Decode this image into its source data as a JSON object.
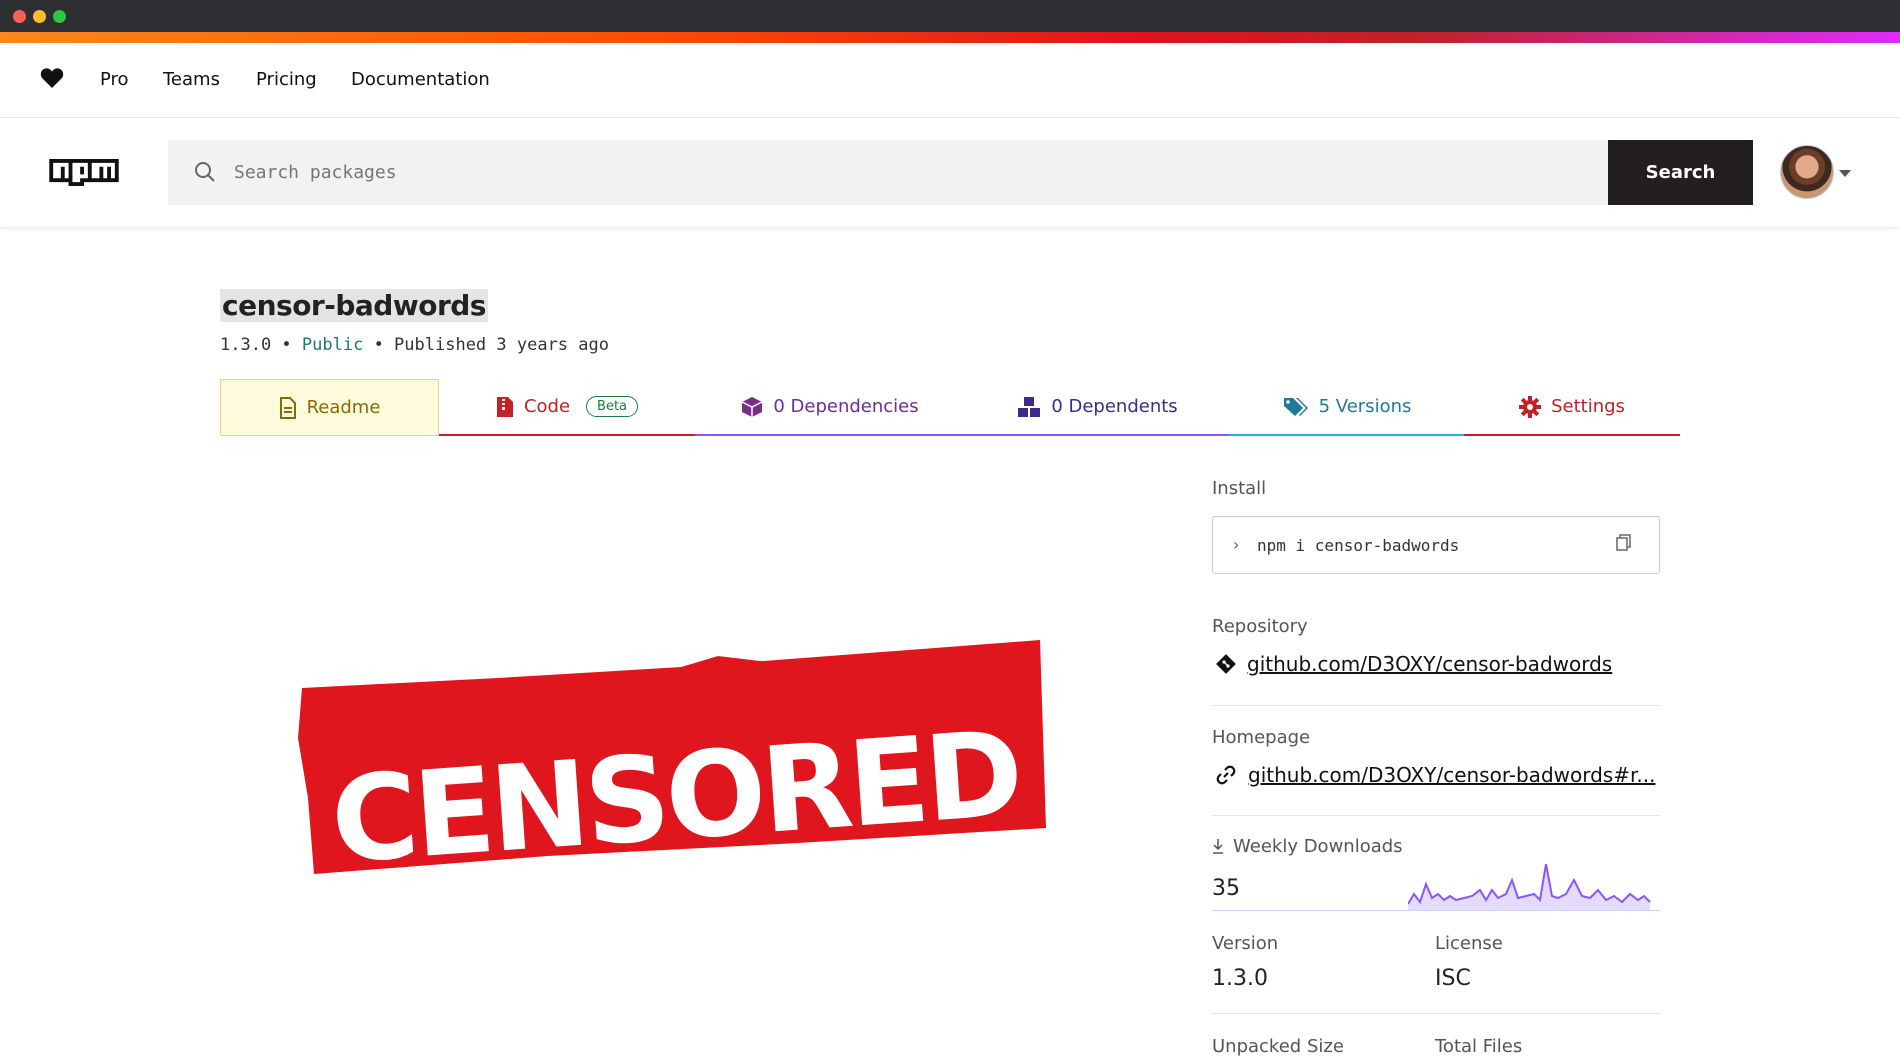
{
  "topnav": {
    "items": [
      "Pro",
      "Teams",
      "Pricing",
      "Documentation"
    ]
  },
  "header": {
    "search_placeholder": "Search packages",
    "search_button": "Search"
  },
  "package": {
    "name": "censor-badwords",
    "version": "1.3.0",
    "visibility": "Public",
    "published": "Published 3 years ago"
  },
  "tabs": {
    "readme": "Readme",
    "code": "Code",
    "code_badge": "Beta",
    "dependencies": "0 Dependencies",
    "dependents": "0 Dependents",
    "versions": "5 Versions",
    "settings": "Settings"
  },
  "readme": {
    "image_text": "CENSORED"
  },
  "sidebar": {
    "install_label": "Install",
    "install_cmd": "npm i censor-badwords",
    "repository_label": "Repository",
    "repository_link": "github.com/D3OXY/censor-badwords",
    "homepage_label": "Homepage",
    "homepage_link": "github.com/D3OXY/censor-badwords#r...",
    "weekly_downloads_label": "Weekly Downloads",
    "weekly_downloads": "35",
    "version_label": "Version",
    "version": "1.3.0",
    "license_label": "License",
    "license": "ISC",
    "unpacked_size_label": "Unpacked Size",
    "total_files_label": "Total Files"
  },
  "colors": {
    "brand_red": "#c12127",
    "dependencies_purple": "#8956ff",
    "versions_blue": "#29abe2",
    "readme_bg": "#fffbdd"
  }
}
